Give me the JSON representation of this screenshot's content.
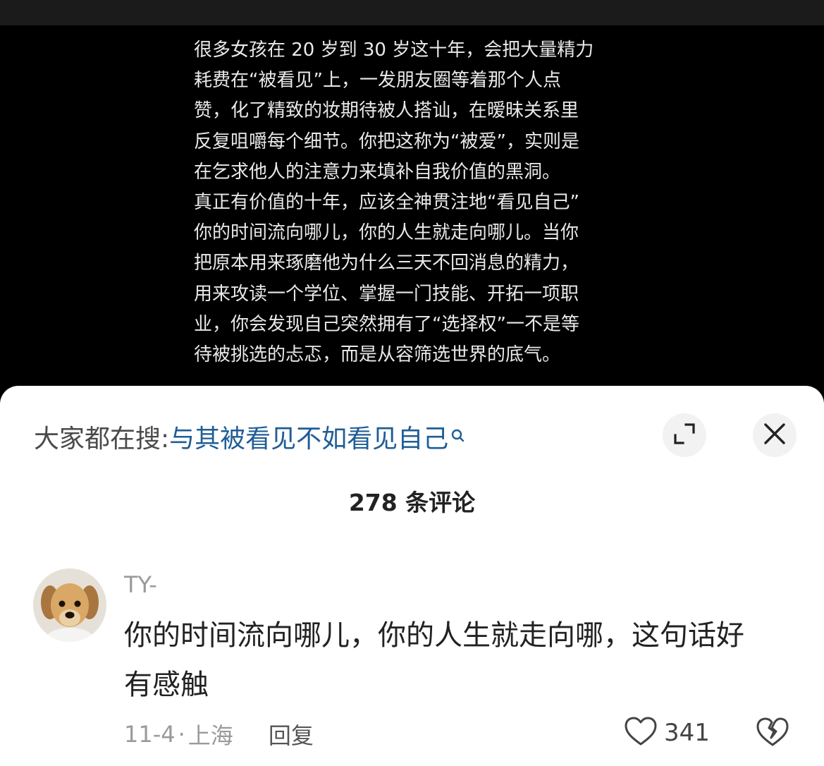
{
  "caption": {
    "lines": [
      "很多女孩在 20 岁到 30 岁这十年，会把大量精力",
      "耗费在“被看见”上，一发朋友圈等着那个人点",
      "赞，化了精致的妆期待被人搭讪，在暧昧关系里",
      "反复咀嚼每个细节。你把这称为“被爱”，实则是",
      "在乞求他人的注意力来填补自我价值的黑洞。",
      "真正有价值的十年，应该全神贯注地“看见自己”",
      "你的时间流向哪儿，你的人生就走向哪儿。当你",
      "把原本用来琢磨他为什么三天不回消息的精力，",
      "用来攻读一个学位、掌握一门技能、开拓一项职",
      "业，你会发现自己突然拥有了“选择权”一不是等",
      "待被挑选的忐忑，而是从容筛选世界的底气。"
    ]
  },
  "search": {
    "prefix": "大家都在搜:",
    "query": "与其被看见不如看见自己",
    "query_color": "#1f5d96"
  },
  "comments_header": {
    "count_label": "278 条评论"
  },
  "comment": {
    "username": "TY-",
    "body_lines": [
      "你的时间流向哪儿，你的人生就走向哪，这句话好",
      "有感触"
    ],
    "date": "11-4",
    "separator": "·",
    "location": "上海",
    "reply_label": "回复",
    "like_count": "341"
  },
  "icons": {
    "search": "search-icon",
    "expand": "expand-icon",
    "close": "close-icon",
    "like": "heart-icon",
    "dislike": "broken-heart-icon",
    "avatar": "puppy-avatar"
  }
}
